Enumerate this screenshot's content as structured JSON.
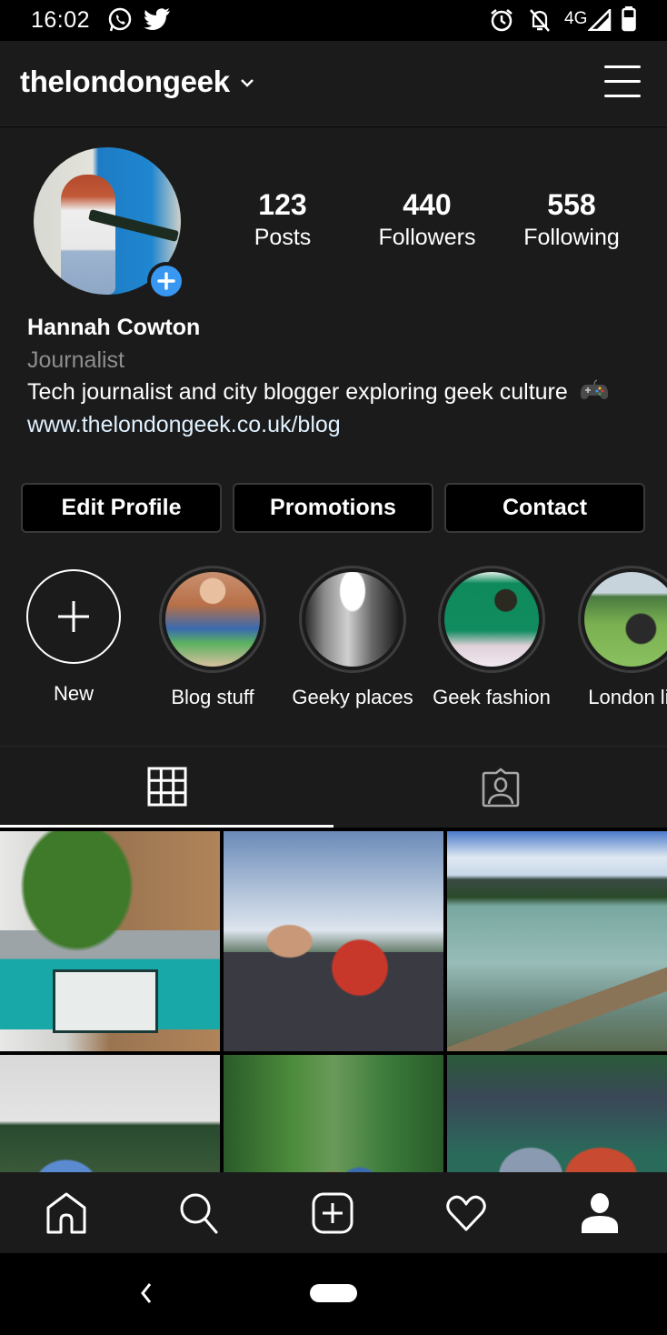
{
  "status_bar": {
    "time": "16:02",
    "notification_icons": [
      "whatsapp-icon",
      "twitter-icon"
    ],
    "system_icons": [
      "alarm-icon",
      "notifications-off-icon",
      "signal-icon",
      "battery-icon"
    ],
    "network": "4G"
  },
  "header": {
    "username": "thelondongeek",
    "account_switcher_icon": "chevron-down-icon",
    "menu_icon": "hamburger-menu-icon"
  },
  "profile": {
    "stats": [
      {
        "value": "123",
        "label": "Posts"
      },
      {
        "value": "440",
        "label": "Followers"
      },
      {
        "value": "558",
        "label": "Following"
      }
    ],
    "display_name": "Hannah Cowton",
    "category": "Journalist",
    "bio": "Tech journalist and city blogger exploring geek culture",
    "bio_emoji": "video-game-controller",
    "website": "www.thelondongeek.co.uk/blog",
    "accent_color": "#3897f0"
  },
  "actions": [
    {
      "label": "Edit Profile"
    },
    {
      "label": "Promotions"
    },
    {
      "label": "Contact"
    }
  ],
  "highlights": [
    {
      "label": "New",
      "type": "new",
      "has_dot": true
    },
    {
      "label": "Blog stuff",
      "type": "highlight"
    },
    {
      "label": "Geeky places",
      "type": "highlight"
    },
    {
      "label": "Geek fashion",
      "type": "highlight"
    },
    {
      "label": "London life",
      "visible_label": "London lit",
      "type": "highlight"
    }
  ],
  "tabs": [
    {
      "name": "grid",
      "icon": "grid-icon",
      "active": true
    },
    {
      "name": "tagged",
      "icon": "tagged-person-icon",
      "active": false
    }
  ],
  "posts": [
    {
      "alt": "Turquoise Nintendo Switch Lite with potted plant"
    },
    {
      "alt": "Couple selfie with forest and sea view"
    },
    {
      "alt": "Mountain lake with log"
    },
    {
      "alt": "Lake with striped umbrella and trees"
    },
    {
      "alt": "Suspension bridge in forest"
    },
    {
      "alt": "Couple sitting on green bench"
    }
  ],
  "bottom_nav": [
    {
      "name": "home",
      "icon": "home-icon"
    },
    {
      "name": "search",
      "icon": "search-icon"
    },
    {
      "name": "new-post",
      "icon": "add-post-icon"
    },
    {
      "name": "activity",
      "icon": "heart-icon"
    },
    {
      "name": "profile",
      "icon": "profile-icon",
      "active": true
    }
  ]
}
